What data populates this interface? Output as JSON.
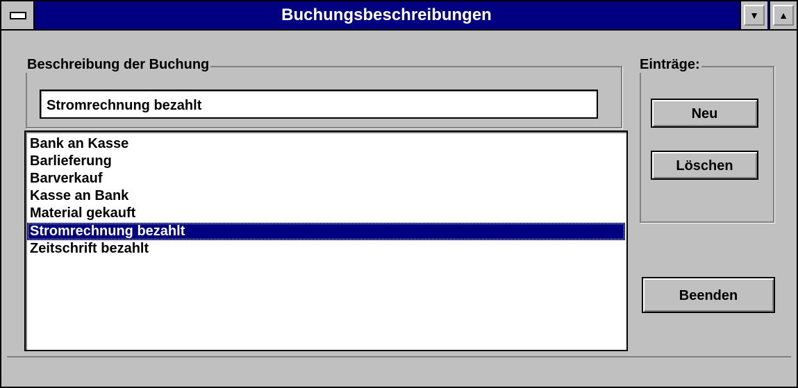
{
  "window": {
    "title": "Buchungsbeschreibungen"
  },
  "description_group": {
    "label": "Beschreibung der Buchung",
    "value": "Stromrechnung bezahlt"
  },
  "entries_list": {
    "items": [
      "Bank an Kasse",
      "Barlieferung",
      "Barverkauf",
      "Kasse an Bank",
      "Material gekauft",
      "Stromrechnung bezahlt",
      "Zeitschrift bezahlt"
    ],
    "selected": "Stromrechnung bezahlt"
  },
  "entries_group": {
    "label": "Einträge:",
    "new_label": "Neu",
    "delete_label": "Löschen"
  },
  "exit_label": "Beenden",
  "titlebar_buttons": {
    "minimize_glyph": "▼",
    "maximize_glyph": "▲"
  },
  "colors": {
    "title_bar": "#000080",
    "face": "#c0c0c0",
    "selection": "#000080"
  }
}
